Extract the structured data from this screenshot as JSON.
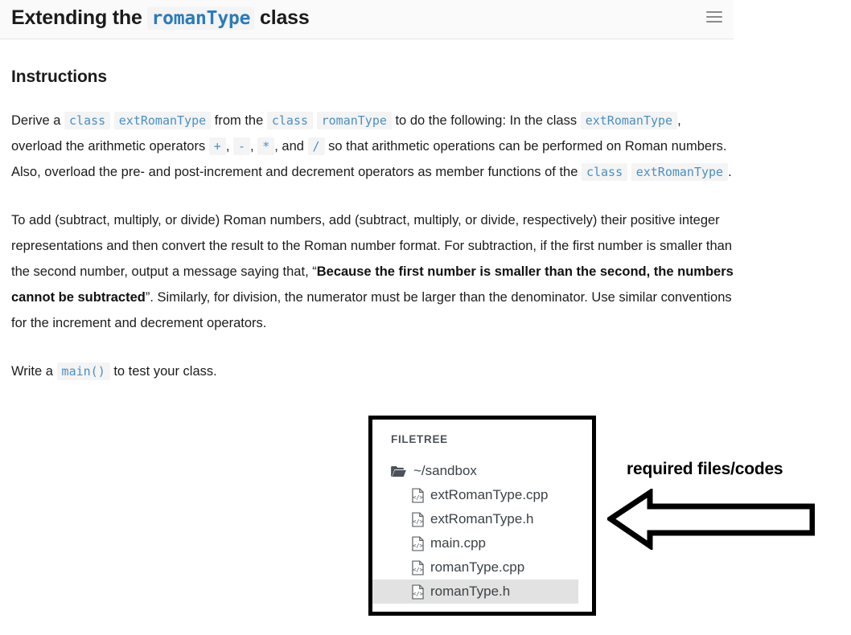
{
  "header": {
    "title_before": "Extending the ",
    "title_code": "romanType",
    "title_after": " class",
    "menu_icon": "hamburger-menu-icon"
  },
  "main": {
    "section_title": "Instructions",
    "paragraph1": {
      "t1": "Derive a ",
      "c1": "class",
      "t2": " ",
      "c2": "extRomanType",
      "t3": " from the ",
      "c3": "class",
      "t4": " ",
      "c4": "romanType",
      "t5": " to do the following: In the class ",
      "c5": "extRomanType",
      "t6": ", overload the arithmetic operators ",
      "c6": "+",
      "t7": ", ",
      "c7": "-",
      "t8": ", ",
      "c8": "*",
      "t9": ", and ",
      "c9": "/",
      "t10": " so that arithmetic operations can be performed on Roman numbers. Also, overload the pre- and post-increment and decrement operators as member functions of the ",
      "c10": "class",
      "t11": " ",
      "c11": "extRomanType",
      "t12": "."
    },
    "paragraph2": {
      "t1": "To add (subtract, multiply, or divide) Roman numbers, add (subtract, multiply, or divide, respectively) their positive integer representations and then convert the result to the Roman number format. For subtraction, if the first number is smaller than the second number, output a message saying that, “",
      "bold": "Because the first number is smaller than the second, the numbers cannot be subtracted",
      "t2": "”. Similarly, for division, the numerator must be larger than the denominator. Use similar conventions for the increment and decrement operators."
    },
    "paragraph3": {
      "t1": "Write a ",
      "c1": "main()",
      "t2": " to test your class."
    }
  },
  "filetree": {
    "label": "FILETREE",
    "root": {
      "name": "~/sandbox",
      "icon": "folder-open-icon"
    },
    "files": [
      {
        "name": "extRomanType.cpp",
        "icon": "code-file-icon",
        "selected": false
      },
      {
        "name": "extRomanType.h",
        "icon": "code-file-icon",
        "selected": false
      },
      {
        "name": "main.cpp",
        "icon": "code-file-icon",
        "selected": false
      },
      {
        "name": "romanType.cpp",
        "icon": "code-file-icon",
        "selected": false
      },
      {
        "name": "romanType.h",
        "icon": "code-file-icon",
        "selected": true
      }
    ]
  },
  "annotation": {
    "text": "required files/codes",
    "arrow_icon": "left-arrow-annotation-icon"
  },
  "colors": {
    "inline_code_text": "#4a90c4",
    "inline_code_bg": "#f4f4f4",
    "title_code_text": "#2b7bb9",
    "header_bg": "#fafafa",
    "selected_row_bg": "#e2e2e2",
    "annotation": "#000000"
  }
}
